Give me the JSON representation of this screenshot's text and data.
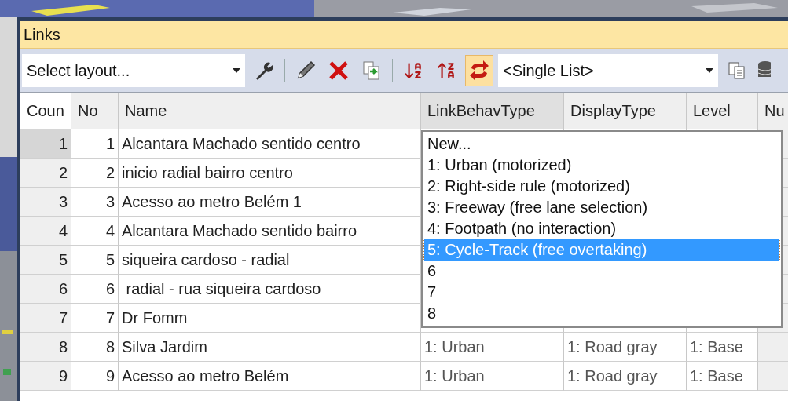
{
  "window": {
    "title": "Links"
  },
  "toolbar": {
    "layout_select": {
      "value": "Select layout..."
    },
    "list_select": {
      "value": "<Single List>"
    },
    "sync_toggle": {
      "on": true
    }
  },
  "table": {
    "columns": [
      "Coun",
      "No",
      "Name",
      "LinkBehavType",
      "DisplayType",
      "Level",
      "Nu"
    ],
    "rows": [
      {
        "count": "1",
        "no": "1",
        "name": "Alcantara Machado sentido centro",
        "selected": true
      },
      {
        "count": "2",
        "no": "2",
        "name": "inicio radial bairro centro",
        "selected": false
      },
      {
        "count": "3",
        "no": "3",
        "name": "Acesso ao metro Belém 1",
        "selected": false
      },
      {
        "count": "4",
        "no": "4",
        "name": "Alcantara Machado sentido bairro",
        "selected": false
      },
      {
        "count": "5",
        "no": "5",
        "name": "siqueira cardoso - radial",
        "selected": false
      },
      {
        "count": "6",
        "no": "6",
        "name": " radial - rua siqueira cardoso",
        "selected": false
      },
      {
        "count": "7",
        "no": "7",
        "name": "Dr Fomm",
        "selected": false
      },
      {
        "count": "8",
        "no": "8",
        "name": "Silva Jardim",
        "link_behav_type": "1: Urban",
        "display_type": "1: Road gray",
        "level": "1: Base",
        "selected": false
      },
      {
        "count": "9",
        "no": "9",
        "name": "Acesso ao metro Belém",
        "link_behav_type": "1: Urban",
        "display_type": "1: Road gray",
        "level": "1: Base",
        "selected": false
      }
    ]
  },
  "dropdown": {
    "items": [
      {
        "label": "New...",
        "selected": false
      },
      {
        "label": "1: Urban (motorized)",
        "selected": false
      },
      {
        "label": "2: Right-side rule (motorized)",
        "selected": false
      },
      {
        "label": "3: Freeway (free lane selection)",
        "selected": false
      },
      {
        "label": "4: Footpath (no interaction)",
        "selected": false
      },
      {
        "label": "5: Cycle-Track (free overtaking)",
        "selected": true
      },
      {
        "label": "6",
        "selected": false
      },
      {
        "label": "7",
        "selected": false
      },
      {
        "label": "8",
        "selected": false
      }
    ]
  }
}
